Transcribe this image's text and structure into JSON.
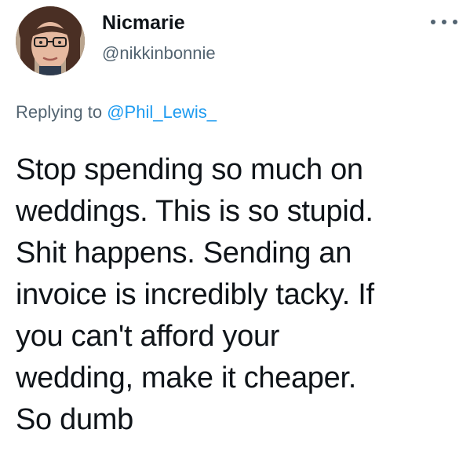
{
  "author": {
    "display_name": "Nicmarie",
    "handle": "@nikkinbonnie"
  },
  "reply_context": {
    "prefix": "Replying to",
    "mention": "@Phil_Lewis_"
  },
  "tweet": {
    "lines": [
      "Stop spending so much on",
      "weddings. This is so stupid.",
      "Shit happens. Sending an",
      "invoice is incredibly tacky. If",
      "you can't afford your",
      "wedding, make it cheaper.",
      "So dumb"
    ]
  },
  "icons": {
    "more": "more-horizontal-icon",
    "avatar": "profile-photo"
  },
  "colors": {
    "text_primary": "#0f1419",
    "text_secondary": "#536471",
    "link": "#1d9bf0",
    "background": "#ffffff"
  }
}
